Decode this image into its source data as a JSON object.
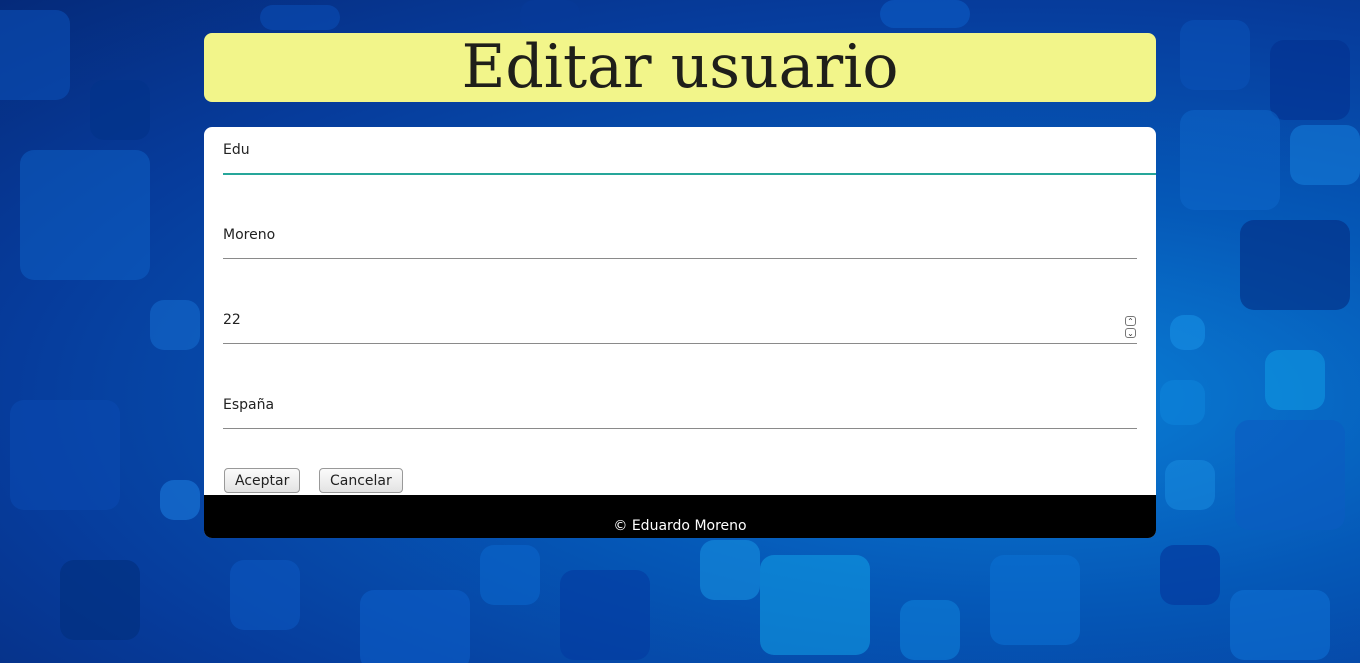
{
  "header": {
    "title": "Editar usuario"
  },
  "form": {
    "nombre": "Edu",
    "apellido": "Moreno",
    "edad": "22",
    "pais": "España",
    "accept_label": "Aceptar",
    "cancel_label": "Cancelar"
  },
  "footer": {
    "text": "© Eduardo Moreno"
  },
  "colors": {
    "header_bg": "#f2f58a",
    "active_underline": "#26a69a",
    "footer_bg": "#000000",
    "background": "#063c9c"
  }
}
